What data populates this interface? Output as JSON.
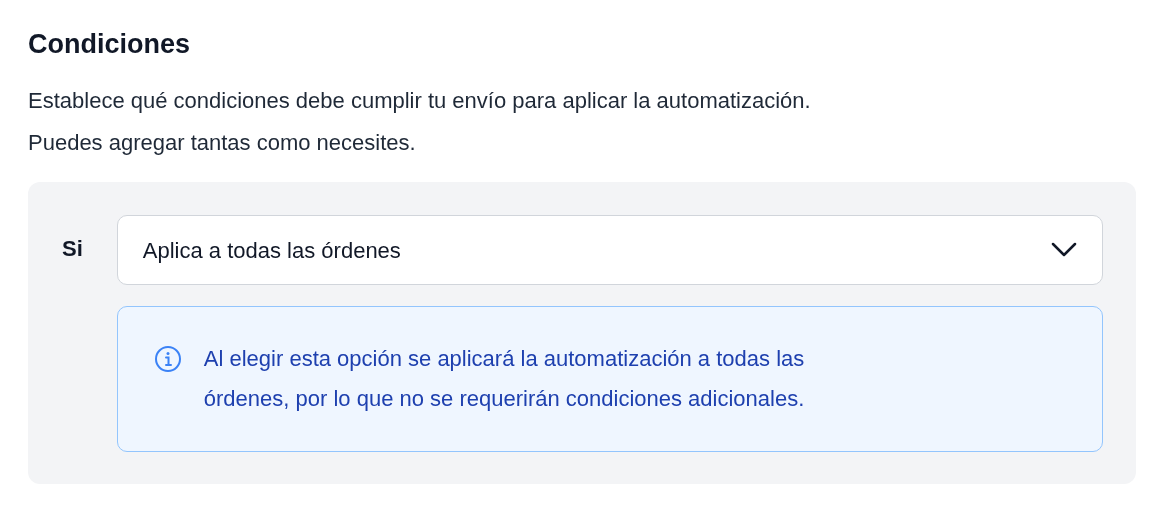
{
  "section": {
    "title": "Condiciones",
    "description_lines": [
      "Establece qué condiciones debe cumplir tu envío para aplicar la automatización.",
      "Puedes agregar tantas como necesites."
    ]
  },
  "condition": {
    "label": "Si",
    "select": {
      "value": "Aplica a todas las órdenes",
      "expanded": false
    },
    "info": {
      "lines": [
        "Al elegir esta opción se aplicará la automatización a todas las",
        "órdenes, por lo que no se requerirán condiciones adicionales."
      ]
    }
  }
}
